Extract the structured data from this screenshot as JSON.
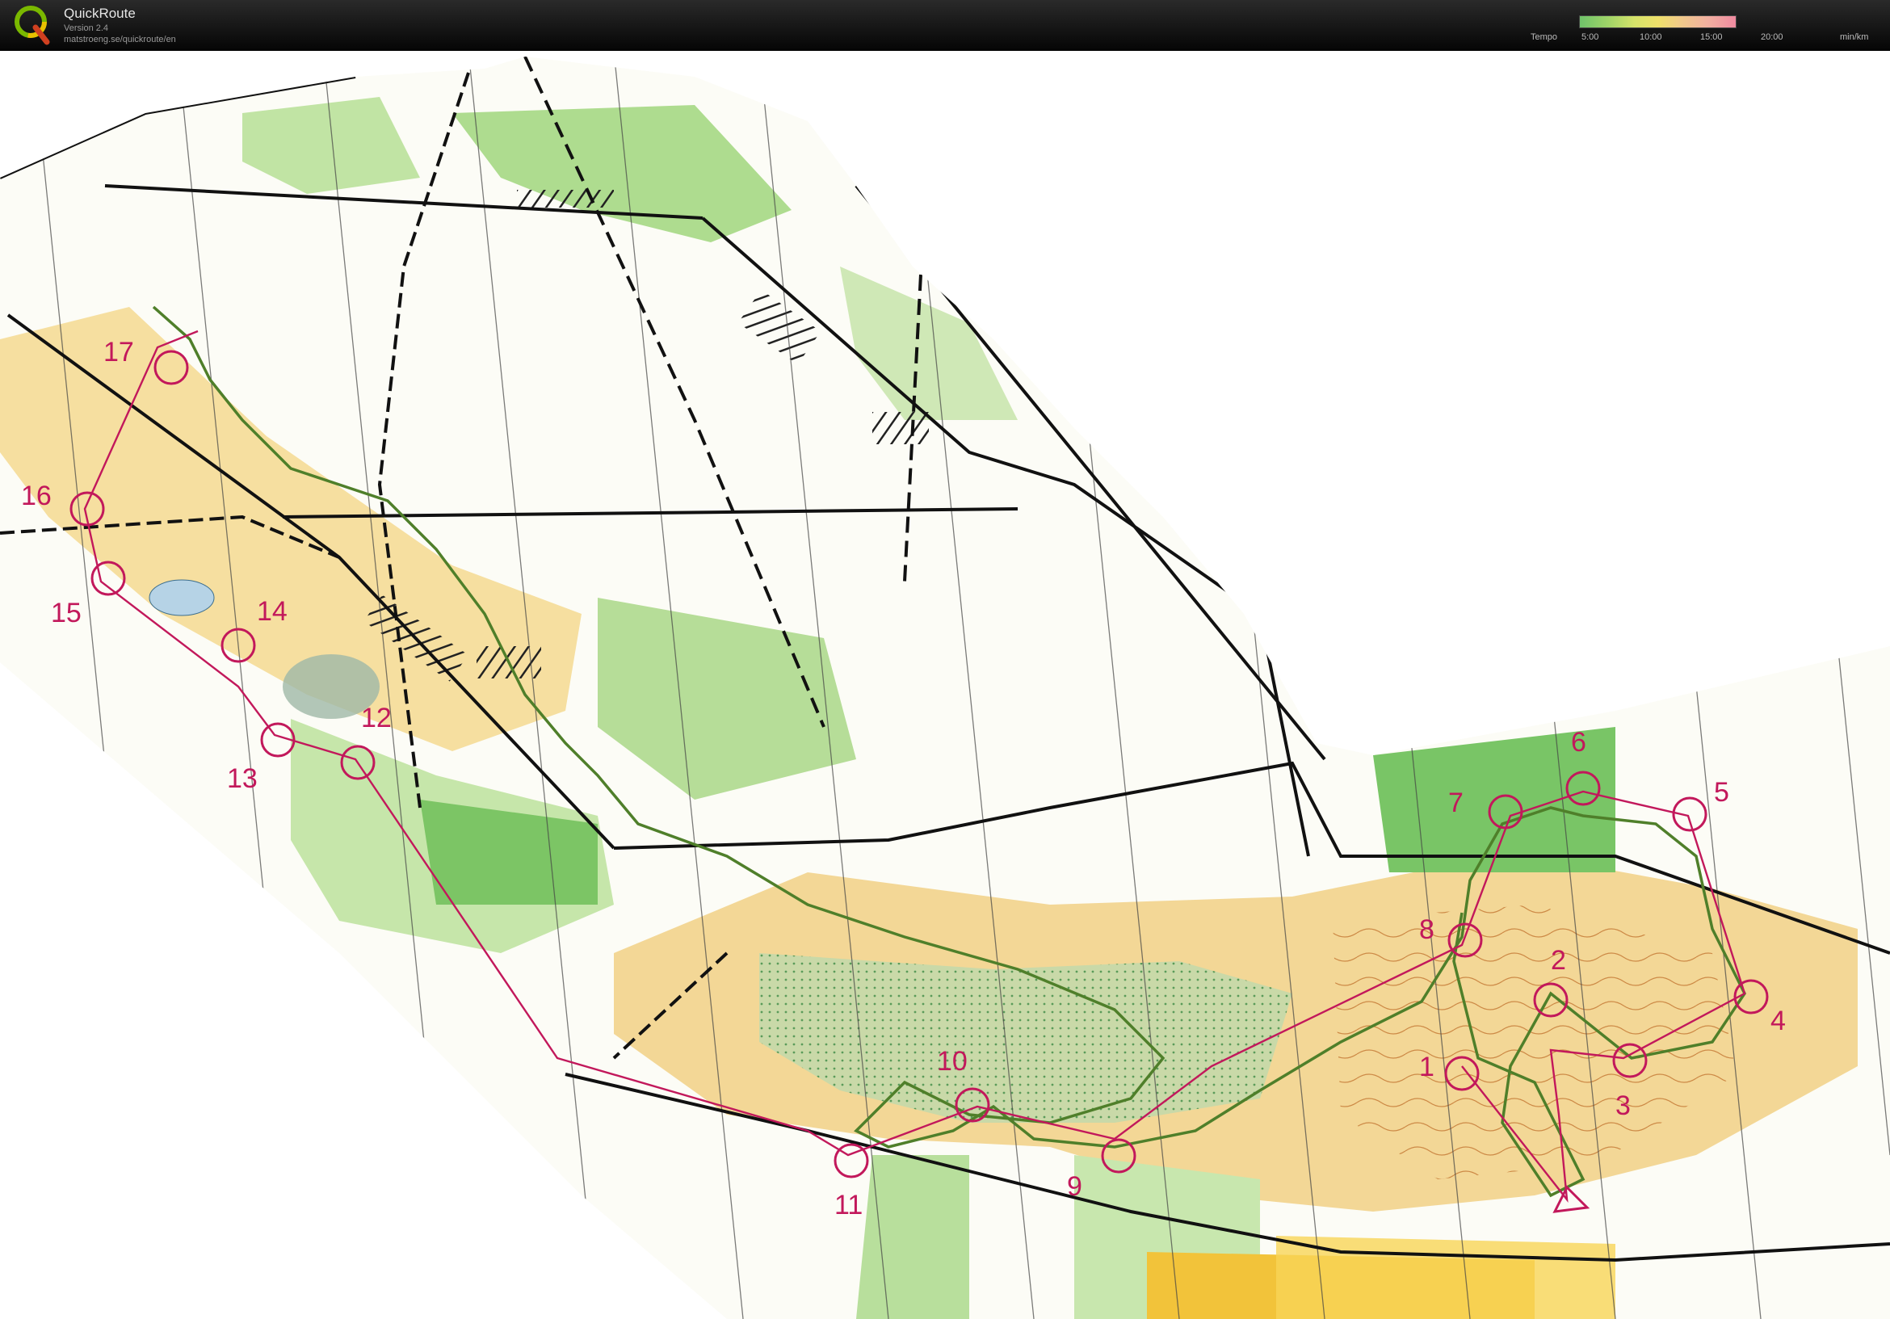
{
  "app": {
    "title": "QuickRoute",
    "version": "Version 2.4",
    "url": "matstroeng.se/quickroute/en"
  },
  "tempo_legend": {
    "label": "Tempo",
    "ticks": [
      "5:00",
      "10:00",
      "15:00",
      "20:00"
    ],
    "unit": "min/km",
    "colors": [
      "#6fc36a",
      "#d5e36a",
      "#f0c98a",
      "#f08aa0"
    ]
  },
  "map": {
    "controls": [
      "1",
      "2",
      "3",
      "4",
      "5",
      "6",
      "7",
      "8",
      "9",
      "10",
      "11",
      "12",
      "13",
      "14",
      "15",
      "16",
      "17"
    ],
    "course_color": "#c2185b",
    "route_color": "#4f7f2a"
  }
}
